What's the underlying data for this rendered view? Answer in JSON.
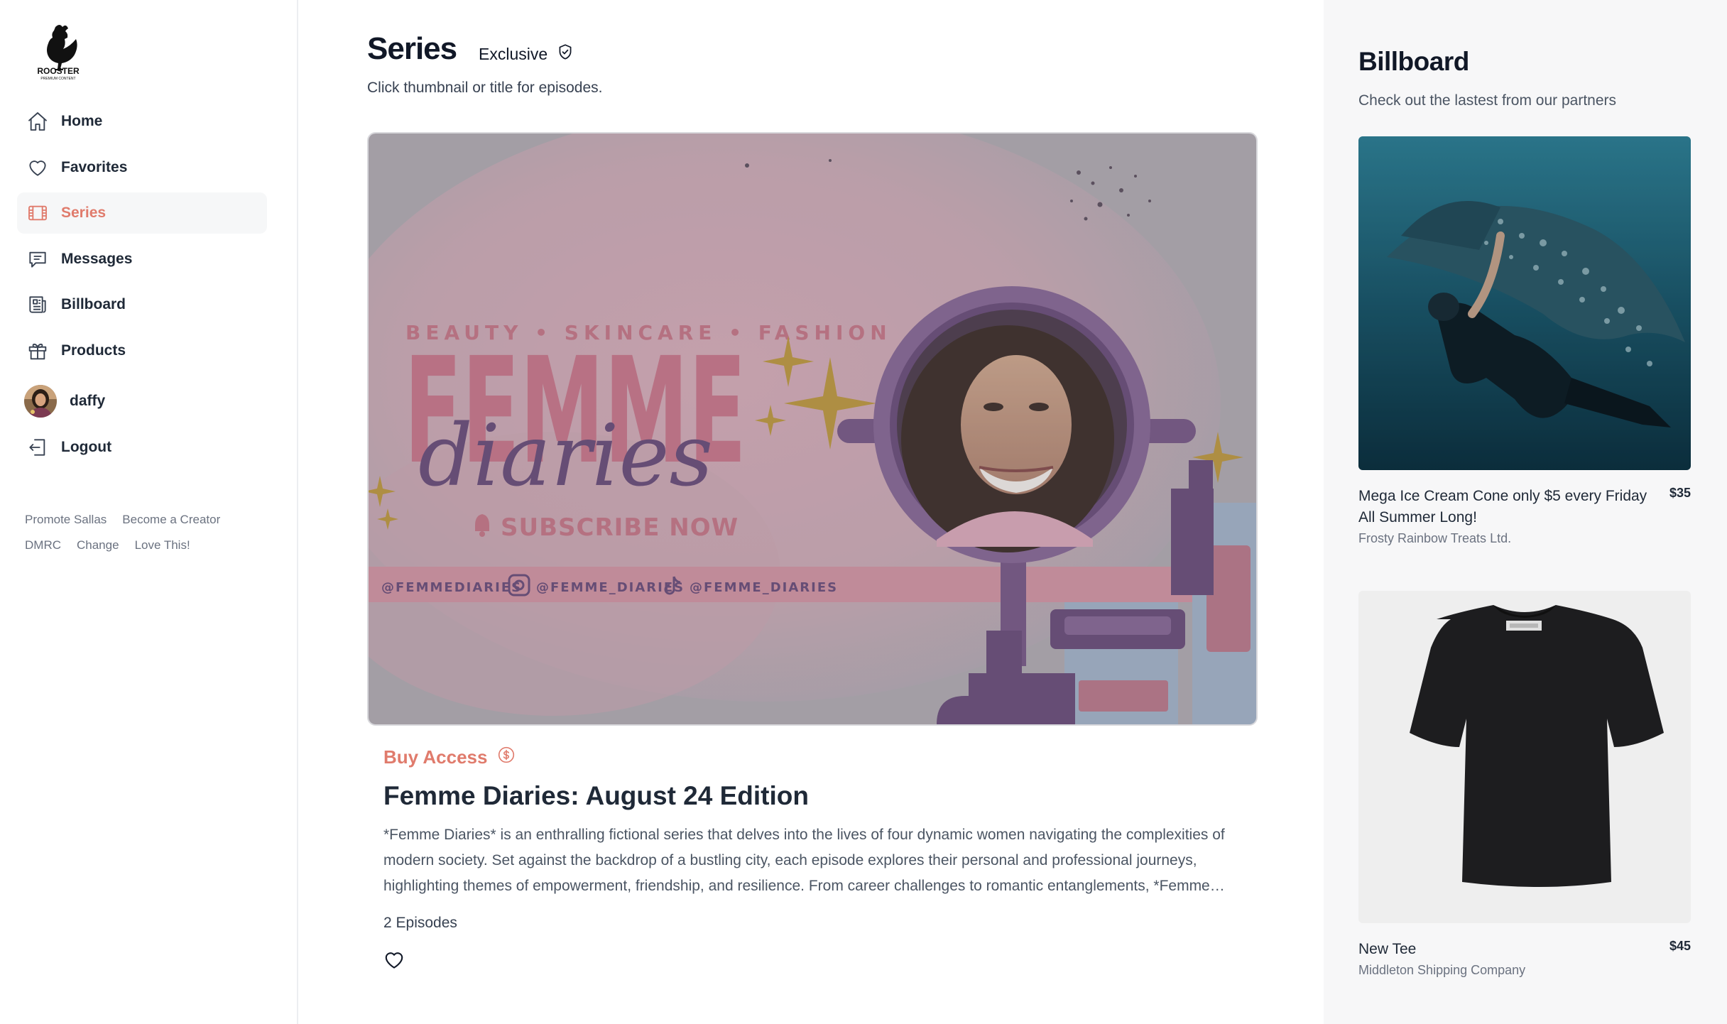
{
  "sidebar": {
    "logo": {
      "name": "ROOSTER",
      "tagline": "PREMIUM CONTENT"
    },
    "nav": [
      {
        "label": "Home",
        "icon": "home-icon"
      },
      {
        "label": "Favorites",
        "icon": "heart-icon"
      },
      {
        "label": "Series",
        "icon": "film-icon",
        "active": true
      },
      {
        "label": "Messages",
        "icon": "chat-icon"
      },
      {
        "label": "Billboard",
        "icon": "newspaper-icon"
      },
      {
        "label": "Products",
        "icon": "gift-icon"
      }
    ],
    "user": {
      "name": "daffy"
    },
    "logout_label": "Logout",
    "footer_links": [
      "Promote Sallas",
      "Become a Creator",
      "DMRC",
      "Change",
      "Love This!"
    ]
  },
  "main": {
    "title": "Series",
    "badge": "Exclusive",
    "subtitle": "Click thumbnail or title for episodes.",
    "thumbnail": {
      "tagline": "BEAUTY • SKINCARE • FASHION",
      "brand_top": "FEMME",
      "brand_script": "diaries",
      "cta": "SUBSCRIBE NOW",
      "socials": [
        "@FEMMEDIARIES",
        "@FEMME_DIARIES",
        "@FEMME_DIARIES"
      ]
    },
    "buy_access_label": "Buy Access",
    "series_title": "Femme Diaries: August 24 Edition",
    "description": "*Femme Diaries* is an enthralling fictional series that delves into the lives of four dynamic women navigating the complexities of modern society. Set against the backdrop of a bustling city, each episode explores their personal and professional journeys, highlighting themes of empowerment, friendship, and resilience. From career challenges to romantic entanglements, *Femme Diaries* offers a compelling look at modern womanhood.",
    "episodes": "2 Episodes"
  },
  "billboard": {
    "title": "Billboard",
    "subtitle": "Check out the lastest from our partners",
    "ads": [
      {
        "name": "Mega Ice Cream Cone only $5 every Friday All Summer Long!",
        "price": "$35",
        "company": "Frosty Rainbow Treats Ltd."
      },
      {
        "name": "New Tee",
        "price": "$45",
        "company": "Middleton Shipping Company"
      }
    ]
  },
  "colors": {
    "accent": "#e07b6c",
    "thumbnail_pink": "#c46b80",
    "thumbnail_purple": "#6b4a7c",
    "thumbnail_gold": "#b8902e"
  }
}
